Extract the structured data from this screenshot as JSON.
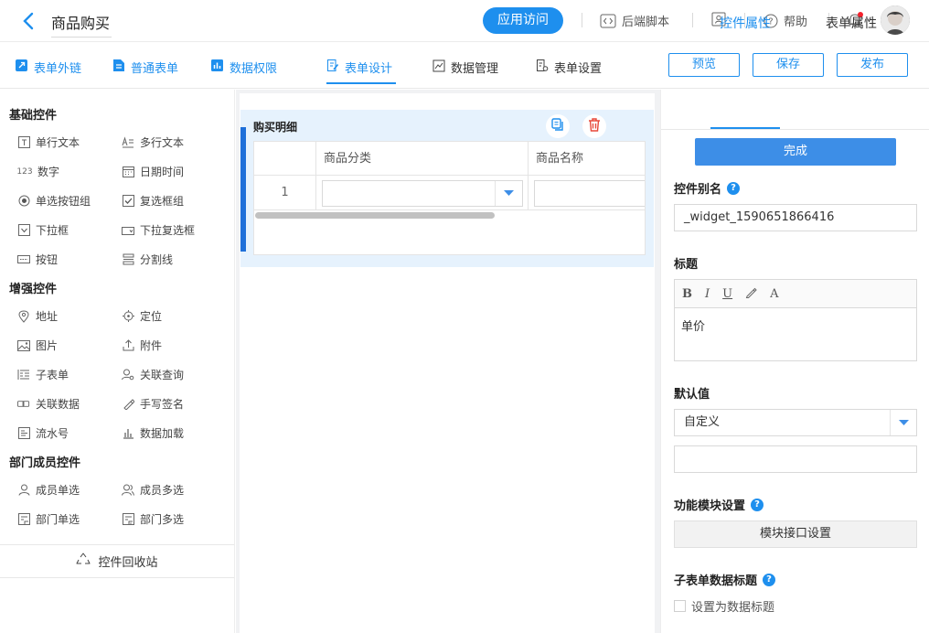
{
  "header": {
    "title": "商品购买",
    "app_access": "应用访问",
    "backend_script": "后端脚本",
    "help": "帮助"
  },
  "nav": {
    "tabs": [
      "表单外链",
      "普通表单",
      "数据权限",
      "表单设计",
      "数据管理",
      "表单设置"
    ],
    "active": "表单设计",
    "buttons": {
      "preview": "预览",
      "save": "保存",
      "publish": "发布"
    }
  },
  "left": {
    "sections": [
      {
        "title": "基础控件",
        "items": [
          "单行文本",
          "多行文本",
          "数字",
          "日期时间",
          "单选按钮组",
          "复选框组",
          "下拉框",
          "下拉复选框",
          "按钮",
          "分割线"
        ]
      },
      {
        "title": "增强控件",
        "items": [
          "地址",
          "定位",
          "图片",
          "附件",
          "子表单",
          "关联查询",
          "关联数据",
          "手写签名",
          "流水号",
          "数据加载"
        ]
      },
      {
        "title": "部门成员控件",
        "items": [
          "成员单选",
          "成员多选",
          "部门单选",
          "部门多选"
        ]
      }
    ],
    "recycle": "控件回收站"
  },
  "canvas": {
    "subform_title": "购买明细",
    "columns": [
      "商品分类",
      "商品名称"
    ],
    "row_number": "1"
  },
  "right": {
    "tabs": [
      "控件属性",
      "表单属性"
    ],
    "done": "完成",
    "alias_label": "控件别名",
    "alias_value": "_widget_1590651866416",
    "title_label": "标题",
    "title_value": "单价",
    "default_label": "默认值",
    "default_select": "自定义",
    "module_label": "功能模块设置",
    "module_button": "模块接口设置",
    "subtitle_label": "子表单数据标题",
    "subtitle_checkbox": "设置为数据标题"
  },
  "colors": {
    "primary": "#1e8fee",
    "accent_bar": "#1e6fd9",
    "danger": "#f5222d"
  }
}
